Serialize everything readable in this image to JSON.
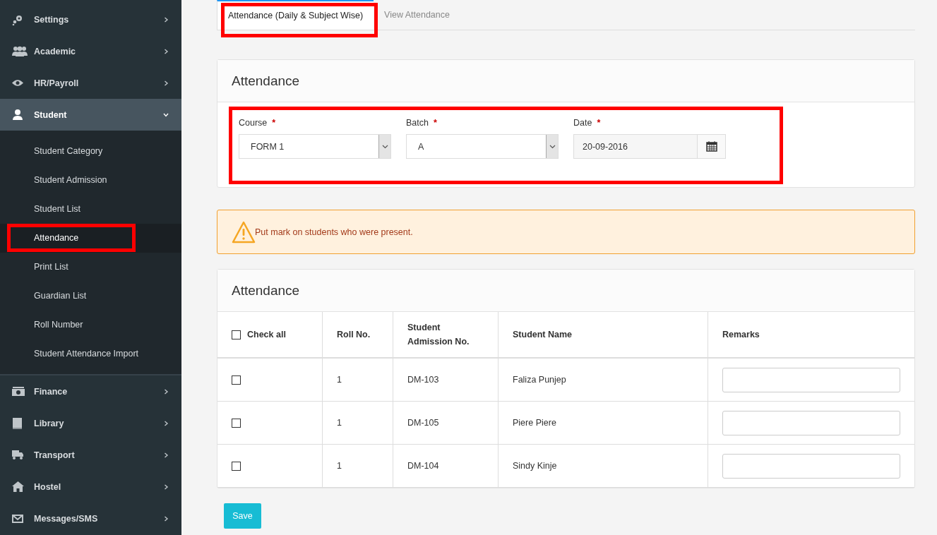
{
  "sidebar": {
    "items": [
      {
        "label": "Settings",
        "expanded": false
      },
      {
        "label": "Academic",
        "expanded": false
      },
      {
        "label": "HR/Payroll",
        "expanded": false
      },
      {
        "label": "Student",
        "expanded": true,
        "children": [
          {
            "label": "Student Category",
            "selected": false,
            "highlighted": false
          },
          {
            "label": "Student Admission",
            "selected": false,
            "highlighted": false
          },
          {
            "label": "Student List",
            "selected": false,
            "highlighted": false
          },
          {
            "label": "Attendance",
            "selected": true,
            "highlighted": true
          },
          {
            "label": "Print List",
            "selected": false,
            "highlighted": false
          },
          {
            "label": "Guardian List",
            "selected": false,
            "highlighted": false
          },
          {
            "label": "Roll Number",
            "selected": false,
            "highlighted": false
          },
          {
            "label": "Student Attendance Import",
            "selected": false,
            "highlighted": false
          }
        ]
      },
      {
        "label": "Finance",
        "expanded": false
      },
      {
        "label": "Library",
        "expanded": false
      },
      {
        "label": "Transport",
        "expanded": false
      },
      {
        "label": "Hostel",
        "expanded": false
      },
      {
        "label": "Messages/SMS",
        "expanded": false
      }
    ]
  },
  "tabs": [
    {
      "label": "Attendance (Daily & Subject Wise)",
      "selected": true,
      "highlighted": true
    },
    {
      "label": "View Attendance",
      "selected": false,
      "highlighted": false
    }
  ],
  "filter_card": {
    "title": "Attendance",
    "highlighted": true,
    "fields": [
      {
        "kind": "select",
        "label": "Course",
        "required_mark": "*",
        "value": "FORM 1"
      },
      {
        "kind": "select",
        "label": "Batch",
        "required_mark": "*",
        "value": "A"
      },
      {
        "kind": "date",
        "label": "Date",
        "required_mark": "*",
        "value": "20-09-2016"
      }
    ]
  },
  "alert": {
    "text": "Put mark on students who were present."
  },
  "table_card": {
    "title": "Attendance",
    "check_all": {
      "label": "Check all",
      "checked": false
    },
    "columns": [
      "Roll No.",
      "Student Admission No.",
      "Student Name",
      "Remarks"
    ],
    "rows": [
      {
        "checked": false,
        "roll_no": "1",
        "admission_no": "DM-103",
        "name": "Faliza Punjep"
      },
      {
        "checked": false,
        "roll_no": "1",
        "admission_no": "DM-105",
        "name": "Piere Piere"
      },
      {
        "checked": false,
        "roll_no": "1",
        "admission_no": "DM-104",
        "name": "Sindy Kinje"
      }
    ]
  },
  "save_button": "Save"
}
